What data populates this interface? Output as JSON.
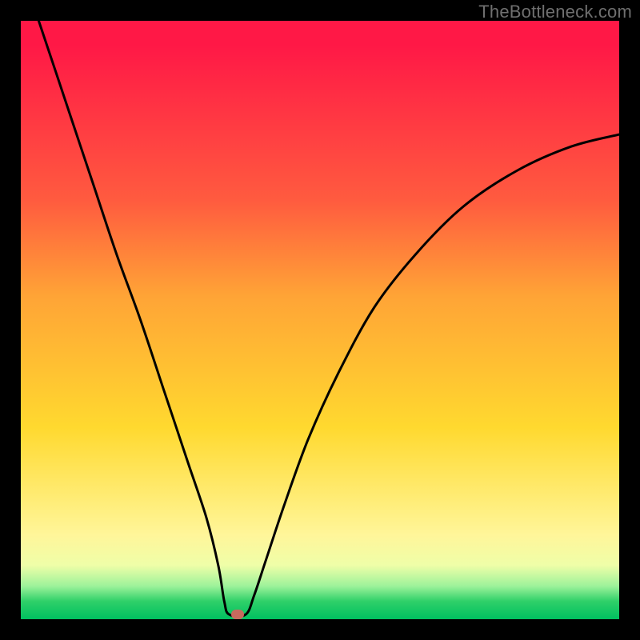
{
  "watermark": "TheBottleneck.com",
  "marker": {
    "x_frac": 0.362,
    "y_frac": 0.992
  },
  "gradient_stops": [
    {
      "pct": 0,
      "hex": "#ff1846"
    },
    {
      "pct": 30,
      "hex": "#ff5b3f"
    },
    {
      "pct": 46,
      "hex": "#ffa436"
    },
    {
      "pct": 68,
      "hex": "#ffd92f"
    },
    {
      "pct": 86,
      "hex": "#fff69a"
    },
    {
      "pct": 95,
      "hex": "#9cf29a"
    },
    {
      "pct": 100,
      "hex": "#00c060"
    }
  ],
  "chart_data": {
    "type": "line",
    "title": "",
    "xlabel": "",
    "ylabel": "",
    "xlim": [
      0,
      1
    ],
    "ylim": [
      0,
      1
    ],
    "note": "Axes are unlabeled; values are fractional positions in the plotting rectangle (origin top-left, y increases downward as rendered).",
    "series": [
      {
        "name": "bottleneck-curve",
        "points": [
          {
            "x": 0.03,
            "y": 0.0
          },
          {
            "x": 0.06,
            "y": 0.09
          },
          {
            "x": 0.09,
            "y": 0.18
          },
          {
            "x": 0.12,
            "y": 0.27
          },
          {
            "x": 0.16,
            "y": 0.39
          },
          {
            "x": 0.2,
            "y": 0.5
          },
          {
            "x": 0.24,
            "y": 0.62
          },
          {
            "x": 0.28,
            "y": 0.74
          },
          {
            "x": 0.31,
            "y": 0.83
          },
          {
            "x": 0.33,
            "y": 0.91
          },
          {
            "x": 0.34,
            "y": 0.97
          },
          {
            "x": 0.348,
            "y": 0.992
          },
          {
            "x": 0.376,
            "y": 0.992
          },
          {
            "x": 0.39,
            "y": 0.96
          },
          {
            "x": 0.41,
            "y": 0.9
          },
          {
            "x": 0.44,
            "y": 0.81
          },
          {
            "x": 0.48,
            "y": 0.7
          },
          {
            "x": 0.53,
            "y": 0.59
          },
          {
            "x": 0.59,
            "y": 0.48
          },
          {
            "x": 0.66,
            "y": 0.39
          },
          {
            "x": 0.74,
            "y": 0.31
          },
          {
            "x": 0.83,
            "y": 0.25
          },
          {
            "x": 0.92,
            "y": 0.21
          },
          {
            "x": 1.0,
            "y": 0.19
          }
        ]
      }
    ]
  }
}
